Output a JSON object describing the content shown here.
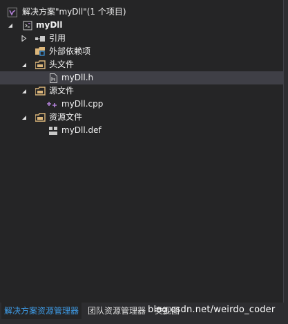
{
  "solution": {
    "title": "解决方案\"myDll\"(1 个项目)"
  },
  "project": {
    "name": "myDll"
  },
  "tree": {
    "references": "引用",
    "external_deps": "外部依赖项",
    "header_files": "头文件",
    "header_file_1": "myDll.h",
    "source_files": "源文件",
    "source_file_1": "myDll.cpp",
    "resource_files": "资源文件",
    "resource_file_1": "myDll.def"
  },
  "tabs": {
    "solution_explorer": "解决方案资源管理器",
    "team_explorer": "团队资源管理器",
    "class_view": "类视图"
  },
  "watermark": "blog.csdn.net/weirdo_coder",
  "colors": {
    "background": "#252526",
    "selected_row": "#3f3f46",
    "active_tab_text": "#3e9be6",
    "folder_icon": "#dcb67a",
    "vs_purple": "#68217a"
  }
}
